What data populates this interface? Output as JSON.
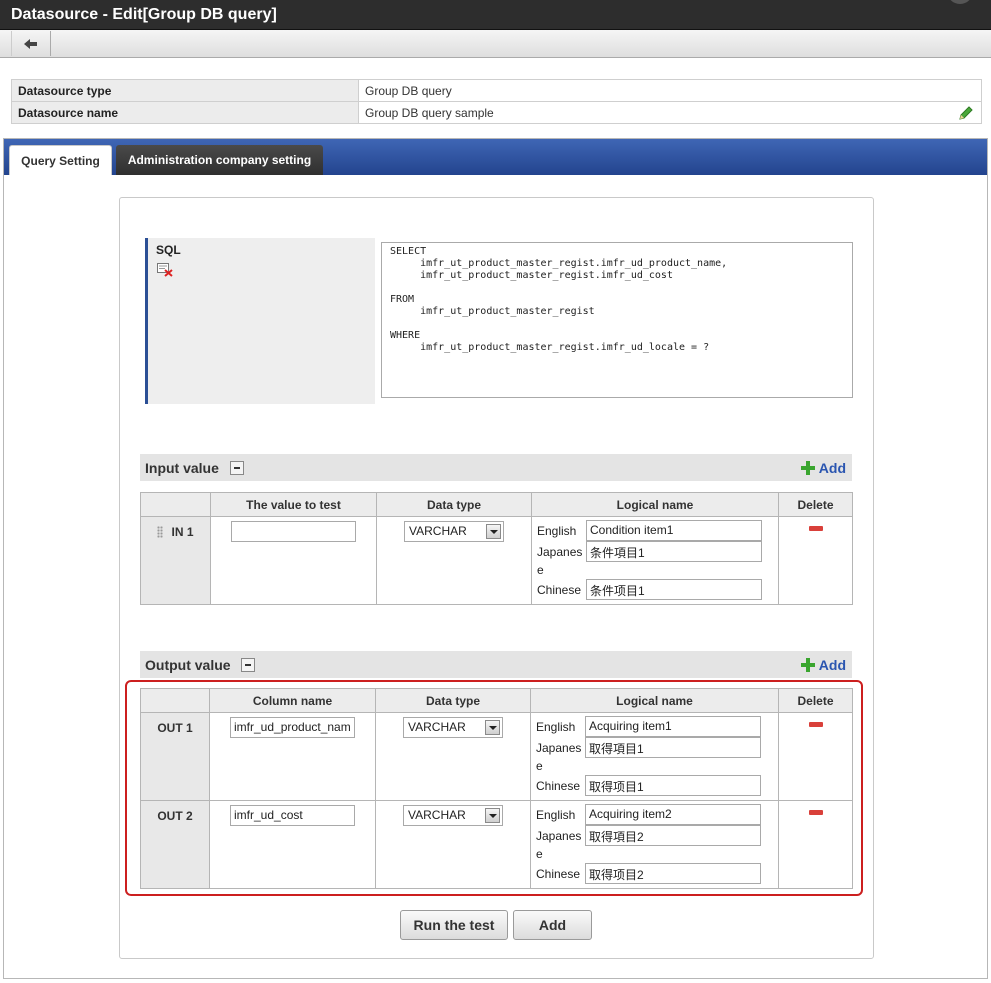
{
  "window": {
    "title": "Datasource - Edit[Group DB query]"
  },
  "toolbar": {
    "back_icon": "arrow-left-icon"
  },
  "info": {
    "type_label": "Datasource type",
    "type_value": "Group DB query",
    "name_label": "Datasource name",
    "name_value": "Group DB query sample"
  },
  "tabs": [
    {
      "label": "Query Setting",
      "active": true
    },
    {
      "label": "Administration company setting",
      "active": false
    }
  ],
  "sql": {
    "label": "SQL",
    "text": "SELECT\n     imfr_ut_product_master_regist.imfr_ud_product_name,\n     imfr_ut_product_master_regist.imfr_ud_cost\n\nFROM\n     imfr_ut_product_master_regist\n\nWHERE\n     imfr_ut_product_master_regist.imfr_ud_locale = ?"
  },
  "input_section": {
    "title": "Input value",
    "add_label": "Add",
    "headers": [
      "",
      "The value to test",
      "Data type",
      "Logical name",
      "Delete"
    ],
    "rows": [
      {
        "label": "IN 1",
        "test_value": "",
        "data_type": "VARCHAR",
        "english_label": "English",
        "english": "Condition item1",
        "japanese_label": "Japanes",
        "japanese_label_wrap": "e",
        "japanese": "条件項目1",
        "chinese_label": "Chinese",
        "chinese": "条件项目1"
      }
    ]
  },
  "output_section": {
    "title": "Output value",
    "add_label": "Add",
    "headers": [
      "",
      "Column name",
      "Data type",
      "Logical name",
      "Delete"
    ],
    "rows": [
      {
        "label": "OUT 1",
        "column": "imfr_ud_product_nam",
        "data_type": "VARCHAR",
        "english_label": "English",
        "english": "Acquiring item1",
        "japanese_label": "Japanes",
        "japanese_label_wrap": "e",
        "japanese": "取得項目1",
        "chinese_label": "Chinese",
        "chinese": "取得项目1"
      },
      {
        "label": "OUT 2",
        "column": "imfr_ud_cost",
        "data_type": "VARCHAR",
        "english_label": "English",
        "english": "Acquiring item2",
        "japanese_label": "Japanes",
        "japanese_label_wrap": "e",
        "japanese": "取得項目2",
        "chinese_label": "Chinese",
        "chinese": "取得项目2"
      }
    ]
  },
  "buttons": {
    "run_test": "Run the test",
    "add": "Add"
  },
  "colors": {
    "tab_bar": "#2d4f9a",
    "highlight": "#cc1f1f",
    "add_plus": "#3aa52f",
    "delete": "#d9403a"
  }
}
